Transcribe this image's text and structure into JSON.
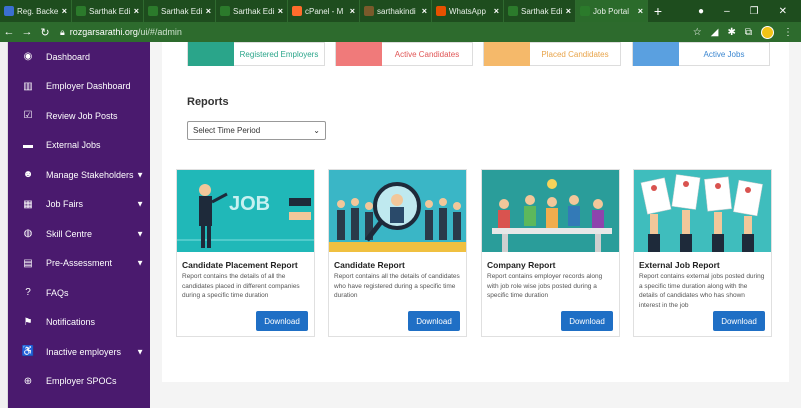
{
  "browser": {
    "tabs": [
      {
        "label": "Reg. Backe",
        "fav_color": "#3b6fd1",
        "active": false
      },
      {
        "label": "Sarthak Edi",
        "fav_color": "#2b7a2b",
        "active": false
      },
      {
        "label": "Sarthak Edi",
        "fav_color": "#2b7a2b",
        "active": false
      },
      {
        "label": "Sarthak Edi",
        "fav_color": "#2b7a2b",
        "active": false
      },
      {
        "label": "cPanel - M",
        "fav_color": "#ff6c2c",
        "active": false
      },
      {
        "label": "sarthakindi",
        "fav_color": "#7a5a2b",
        "active": false
      },
      {
        "label": "WhatsApp",
        "fav_color": "#e65100",
        "active": false
      },
      {
        "label": "Sarthak Edi",
        "fav_color": "#2b7a2b",
        "active": false
      },
      {
        "label": "Job Portal",
        "fav_color": "#2b7a2b",
        "active": true
      }
    ],
    "close_symbol": "×",
    "new_tab_symbol": "+",
    "url_host": "rozgarsarathi.org",
    "url_path": "/ui/#/admin"
  },
  "sidebar": {
    "items": [
      {
        "label": "Dashboard",
        "icon": "dashboard-icon",
        "glyph": "◉",
        "has_chevron": false
      },
      {
        "label": "Employer Dashboard",
        "icon": "chart-icon",
        "glyph": "▥",
        "has_chevron": false
      },
      {
        "label": "Review Job Posts",
        "icon": "review-icon",
        "glyph": "☑",
        "has_chevron": false
      },
      {
        "label": "External Jobs",
        "icon": "briefcase-icon",
        "glyph": "▬",
        "has_chevron": false
      },
      {
        "label": "Manage Stakeholders",
        "icon": "users-icon",
        "glyph": "☻",
        "has_chevron": true
      },
      {
        "label": "Job Fairs",
        "icon": "calendar-icon",
        "glyph": "▦",
        "has_chevron": true
      },
      {
        "label": "Skill Centre",
        "icon": "headset-icon",
        "glyph": "◍",
        "has_chevron": true
      },
      {
        "label": "Pre-Assessment",
        "icon": "clipboard-icon",
        "glyph": "▤",
        "has_chevron": true
      },
      {
        "label": "FAQs",
        "icon": "question-icon",
        "glyph": "?",
        "has_chevron": false
      },
      {
        "label": "Notifications",
        "icon": "flag-icon",
        "glyph": "⚑",
        "has_chevron": false
      },
      {
        "label": "Inactive employers",
        "icon": "inactive-user-icon",
        "glyph": "♿",
        "has_chevron": true
      },
      {
        "label": "Employer SPOCs",
        "icon": "plus-circle-icon",
        "glyph": "⊕",
        "has_chevron": false
      }
    ]
  },
  "stats": [
    {
      "label": "Registered Employers",
      "color": "#2aa58a",
      "text_color": "#2aa58a"
    },
    {
      "label": "Active Candidates",
      "color": "#f07a7a",
      "text_color": "#e05555"
    },
    {
      "label": "Placed Candidates",
      "color": "#f5b96a",
      "text_color": "#e8a44a"
    },
    {
      "label": "Active Jobs",
      "color": "#5aa0e0",
      "text_color": "#3a86d0"
    }
  ],
  "reports": {
    "title": "Reports",
    "select_value": "Select Time Period",
    "cards": [
      {
        "title": "Candidate Placement Report",
        "description": "Report contains the details of all the candidates placed in different companies during a specific time duration",
        "button": "Download",
        "image_text": "JOB",
        "bg": "#20b8b8"
      },
      {
        "title": "Candidate Report",
        "description": "Report contains all the details of candidates who have registered during a specific time duration",
        "button": "Download",
        "image_text": "",
        "bg": "#3ab6c6"
      },
      {
        "title": "Company Report",
        "description": "Report contains employer records along with job role wise jobs posted during a specific time duration",
        "button": "Download",
        "image_text": "",
        "bg": "#2a9d9a"
      },
      {
        "title": "External Job Report",
        "description": "Report contains external jobs posted during a specific time duration along with the details of candidates who has shown interest in the job",
        "button": "Download",
        "image_text": "",
        "bg": "#3fbdbd"
      }
    ]
  }
}
